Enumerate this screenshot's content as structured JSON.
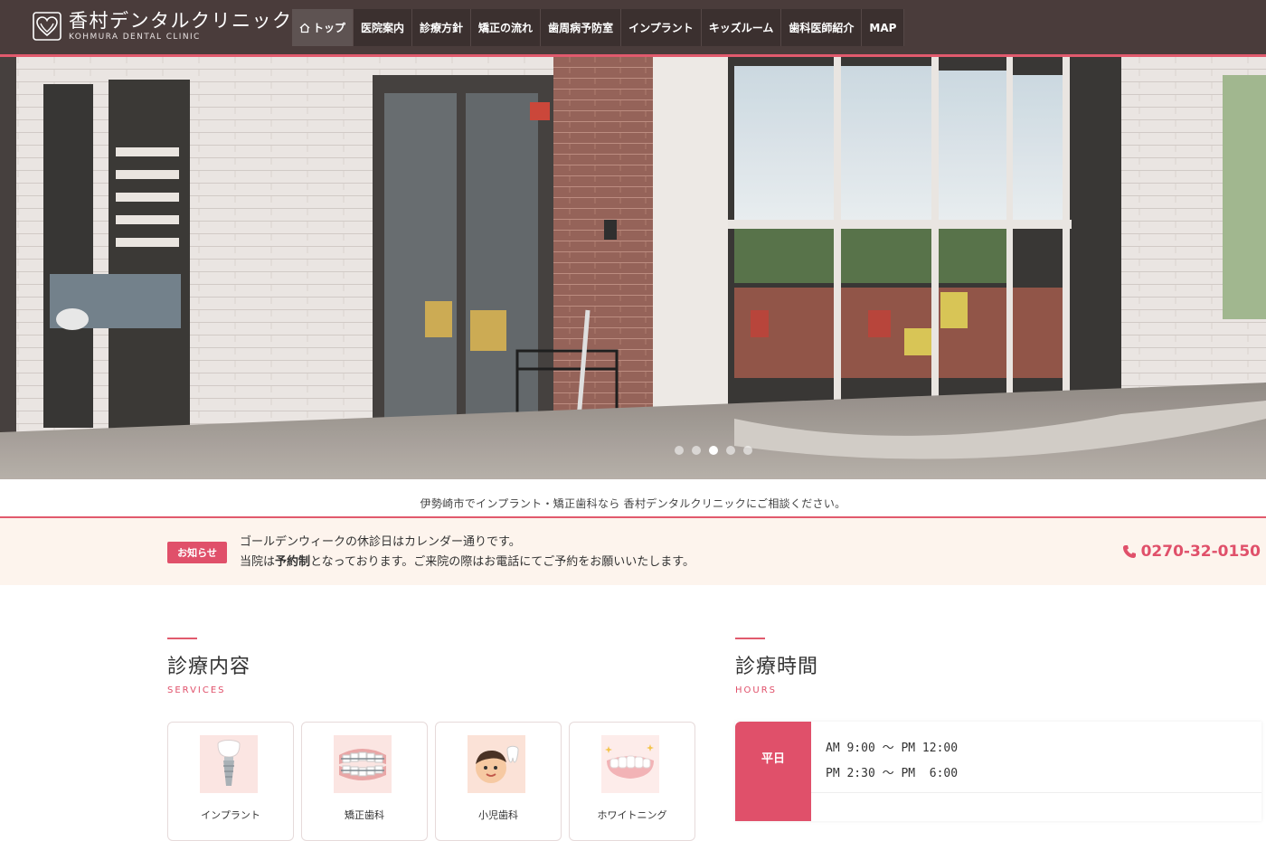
{
  "header": {
    "logo_jp": "香村デンタルクリニック",
    "logo_en": "KOHMURA DENTAL CLINIC",
    "nav": [
      {
        "label": "トップ",
        "active": true
      },
      {
        "label": "医院案内"
      },
      {
        "label": "診療方針"
      },
      {
        "label": "矯正の流れ"
      },
      {
        "label": "歯周病予防室"
      },
      {
        "label": "インプラント"
      },
      {
        "label": "キッズルーム"
      },
      {
        "label": "歯科医師紹介"
      },
      {
        "label": "MAP"
      }
    ]
  },
  "hero": {
    "slide_count": 5,
    "active_slide": 3
  },
  "tagline": "伊勢崎市でインプラント・矯正歯科なら 香村デンタルクリニックにご相談ください。",
  "notice": {
    "badge": "お知らせ",
    "line1": "ゴールデンウィークの休診日はカレンダー通りです。",
    "line2_pre": "当院は",
    "line2_bold": "予約制",
    "line2_post": "となっております。ご来院の際はお電話にてご予約をお願いいたします。",
    "phone": "0270-32-0150"
  },
  "services": {
    "title": "診療内容",
    "subtitle": "SERVICES",
    "cards": [
      {
        "label": "インプラント",
        "icon": "implant-icon"
      },
      {
        "label": "矯正歯科",
        "icon": "braces-icon"
      },
      {
        "label": "小児歯科",
        "icon": "kids-icon"
      },
      {
        "label": "ホワイトニング",
        "icon": "whitening-icon"
      }
    ]
  },
  "hours": {
    "title": "診療時間",
    "subtitle": "HOURS",
    "weekday_label": "平日",
    "rows": [
      "AM 9:00 〜 PM 12:00",
      "PM 2:30 〜 PM  6:00"
    ]
  },
  "colors": {
    "accent": "#e0506a",
    "header_bg": "#4a3c3b",
    "notice_bg": "#fdf4ed"
  }
}
